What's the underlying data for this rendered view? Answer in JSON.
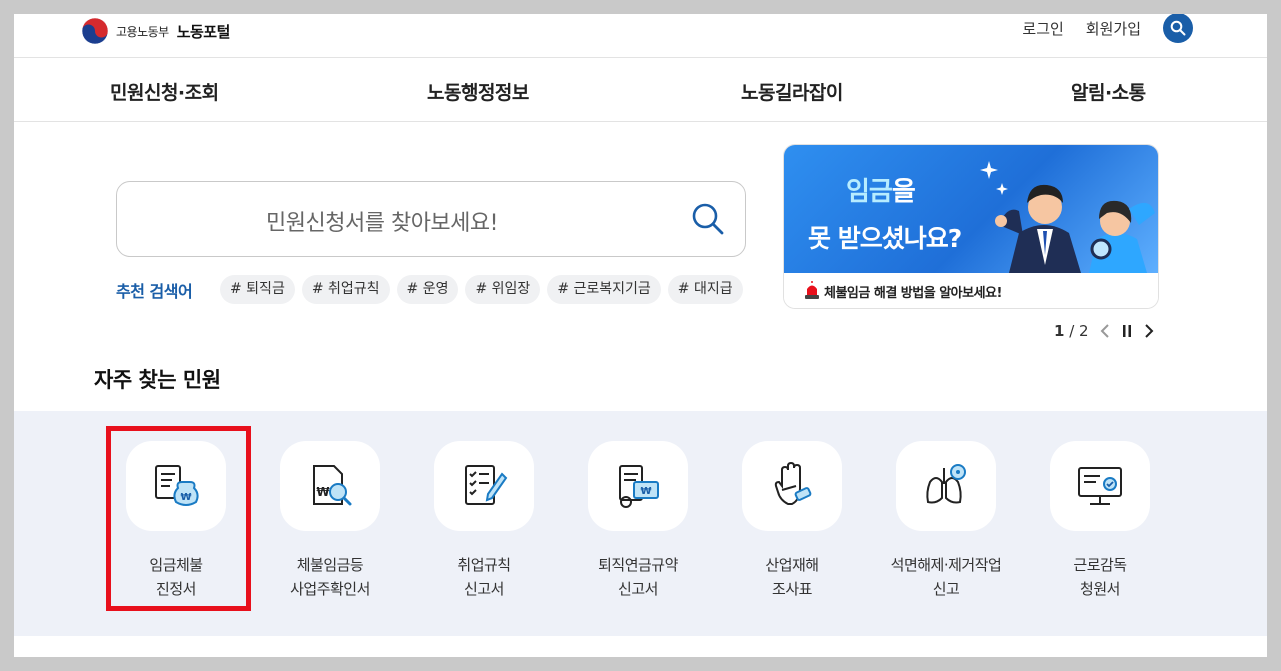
{
  "header": {
    "ministry": "고용노동부",
    "portal": "노동포털",
    "login": "로그인",
    "signup": "회원가입",
    "search_icon": "search-icon"
  },
  "nav": [
    "민원신청·조회",
    "노동행정정보",
    "노동길라잡이",
    "알림·소통"
  ],
  "search": {
    "placeholder": "민원신청서를 찾아보세요!",
    "recommended_label": "추천 검색어",
    "tags": [
      "# 퇴직금",
      "# 취업규칙",
      "# 운영",
      "# 위임장",
      "# 근로복지기금",
      "# 대지급"
    ]
  },
  "banner": {
    "line1_highlight": "임금",
    "line1_rest": "을",
    "line2": "못 받으셨나요?",
    "caption": "체불임금 해결 방법을 알아보세요!",
    "page_current": "1",
    "page_total": "2"
  },
  "frequent": {
    "title": "자주 찾는 민원",
    "items": [
      {
        "line1": "임금체불",
        "line2": "진정서",
        "icon": "wage-claim-icon"
      },
      {
        "line1": "체불임금등",
        "line2": "사업주확인서",
        "icon": "document-search-icon"
      },
      {
        "line1": "취업규칙",
        "line2": "신고서",
        "icon": "checklist-pen-icon"
      },
      {
        "line1": "퇴직연금규약",
        "line2": "신고서",
        "icon": "certificate-icon"
      },
      {
        "line1": "산업재해",
        "line2": "조사표",
        "icon": "injured-hand-icon"
      },
      {
        "line1": "석면해제·제거작업",
        "line2": "신고",
        "icon": "lungs-icon"
      },
      {
        "line1": "근로감독",
        "line2": "청원서",
        "icon": "monitor-check-icon"
      }
    ]
  },
  "colors": {
    "brand_blue": "#1a5ea8",
    "highlight_red": "#e8101c",
    "band_bg": "#eef1f8"
  }
}
